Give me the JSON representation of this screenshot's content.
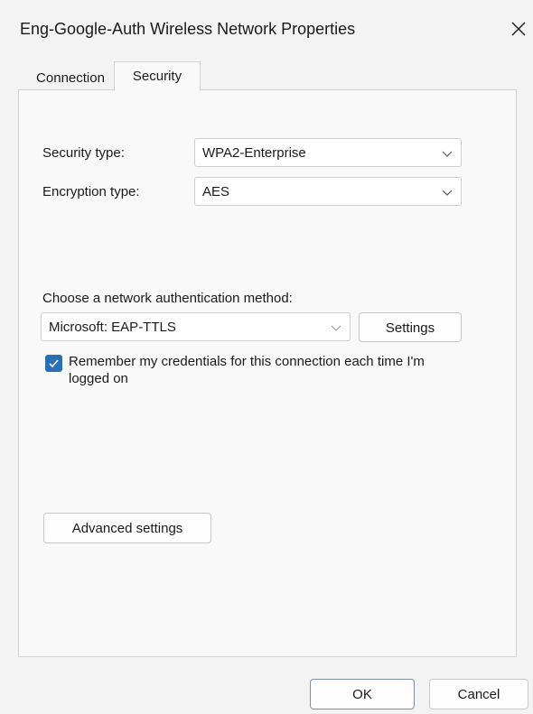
{
  "window": {
    "title": "Eng-Google-Auth Wireless Network Properties",
    "close_icon": "close-icon"
  },
  "tabs": [
    {
      "label": "Connection",
      "selected": false
    },
    {
      "label": "Security",
      "selected": true
    }
  ],
  "security": {
    "security_type_label": "Security type:",
    "security_type_value": "WPA2-Enterprise",
    "encryption_type_label": "Encryption type:",
    "encryption_type_value": "AES",
    "auth_method_label": "Choose a network authentication method:",
    "auth_method_value": "Microsoft: EAP-TTLS",
    "settings_label": "Settings",
    "remember_label": "Remember my credentials for this connection each time I'm logged on",
    "remember_checked": true,
    "advanced_label": "Advanced settings"
  },
  "footer": {
    "ok_label": "OK",
    "cancel_label": "Cancel"
  },
  "colors": {
    "accent": "#2a6fb5",
    "background": "#f3f3f3"
  }
}
